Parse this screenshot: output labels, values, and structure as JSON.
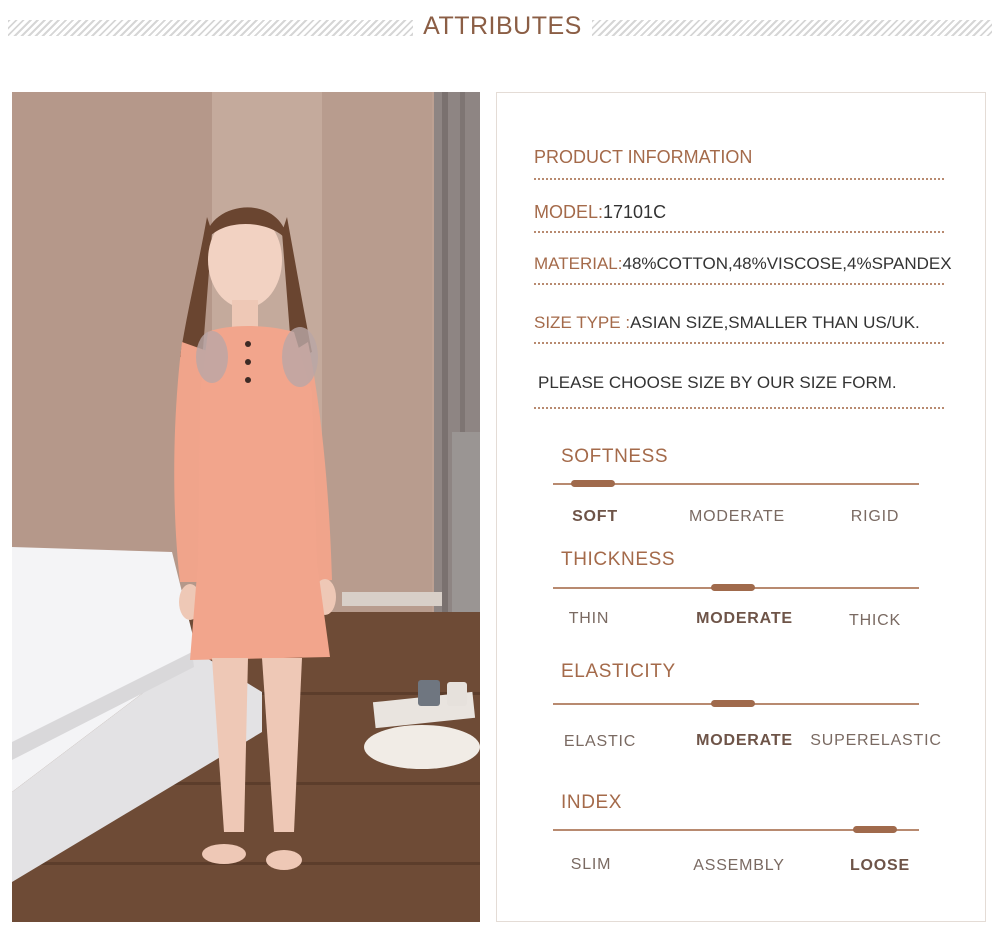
{
  "header": {
    "title": "ATTRIBUTES"
  },
  "info": {
    "heading": "PRODUCT INFORMATION",
    "model": {
      "label": "MODEL:",
      "value": "17101C"
    },
    "material": {
      "label": "MATERIAL:",
      "value": "48%COTTON,48%VISCOSE,4%SPANDEX"
    },
    "size_type": {
      "label": "SIZE TYPE :",
      "value": "ASIAN SIZE,SMALLER THAN US/UK."
    },
    "note": "PLEASE CHOOSE SIZE BY OUR SIZE FORM."
  },
  "attributes": [
    {
      "title": "SOFTNESS",
      "options": [
        "SOFT",
        "MODERATE",
        "RIGID"
      ],
      "selected": 0
    },
    {
      "title": "THICKNESS",
      "options": [
        "THIN",
        "MODERATE",
        "THICK"
      ],
      "selected": 1
    },
    {
      "title": "ELASTICITY",
      "options": [
        "ELASTIC",
        "MODERATE",
        "SUPERELASTIC"
      ],
      "selected": 1
    },
    {
      "title": "INDEX",
      "options": [
        "SLIM",
        "ASSEMBLY",
        "LOOSE"
      ],
      "selected": 2
    }
  ],
  "colors": {
    "accent": "#a46a4a",
    "dress": "#f2a58c",
    "wall": "#b89c8c",
    "floor": "#6b4a35"
  }
}
